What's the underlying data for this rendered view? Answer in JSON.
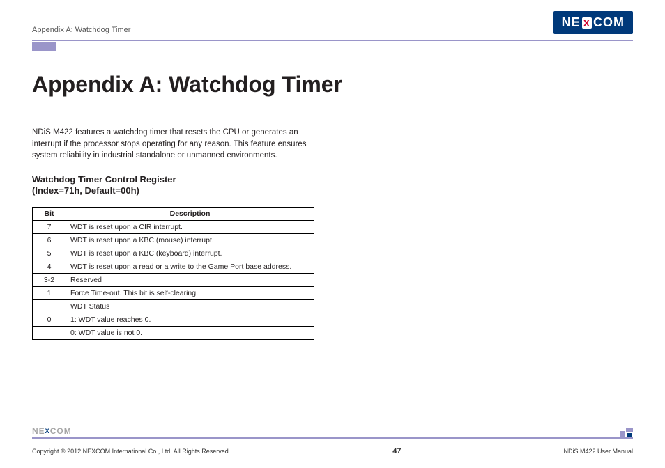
{
  "header": {
    "section": "Appendix A: Watchdog Timer",
    "logo": {
      "pre": "NE",
      "x": "X",
      "post": "COM"
    }
  },
  "title": "Appendix A: Watchdog Timer",
  "intro": "NDiS M422 features a watchdog timer that resets the CPU or generates an interrupt if the processor stops operating for any reason. This feature ensures system reliability in industrial standalone or unmanned environments.",
  "register_heading_line1": "Watchdog Timer Control Register",
  "register_heading_line2": "(Index=71h, Default=00h)",
  "table": {
    "headers": {
      "bit": "Bit",
      "desc": "Description"
    },
    "rows": [
      {
        "bit": "7",
        "desc": "WDT is reset upon a CIR interrupt."
      },
      {
        "bit": "6",
        "desc": "WDT is reset upon a KBC (mouse) interrupt."
      },
      {
        "bit": "5",
        "desc": "WDT is reset upon a KBC (keyboard) interrupt."
      },
      {
        "bit": "4",
        "desc": "WDT is reset upon a read or a write to the Game Port base address."
      },
      {
        "bit": "3-2",
        "desc": "Reserved"
      },
      {
        "bit": "1",
        "desc": "Force Time-out. This bit is self-clearing."
      },
      {
        "bit": "",
        "desc": "WDT Status"
      },
      {
        "bit": "0",
        "desc": "1: WDT value reaches 0."
      },
      {
        "bit": "",
        "desc": "0: WDT value is not 0."
      }
    ]
  },
  "footer": {
    "logo": {
      "pre": "NE",
      "x": "X",
      "post": "COM"
    },
    "copyright": "Copyright © 2012 NEXCOM International Co., Ltd. All Rights Reserved.",
    "page": "47",
    "manual": "NDiS M422 User Manual"
  }
}
